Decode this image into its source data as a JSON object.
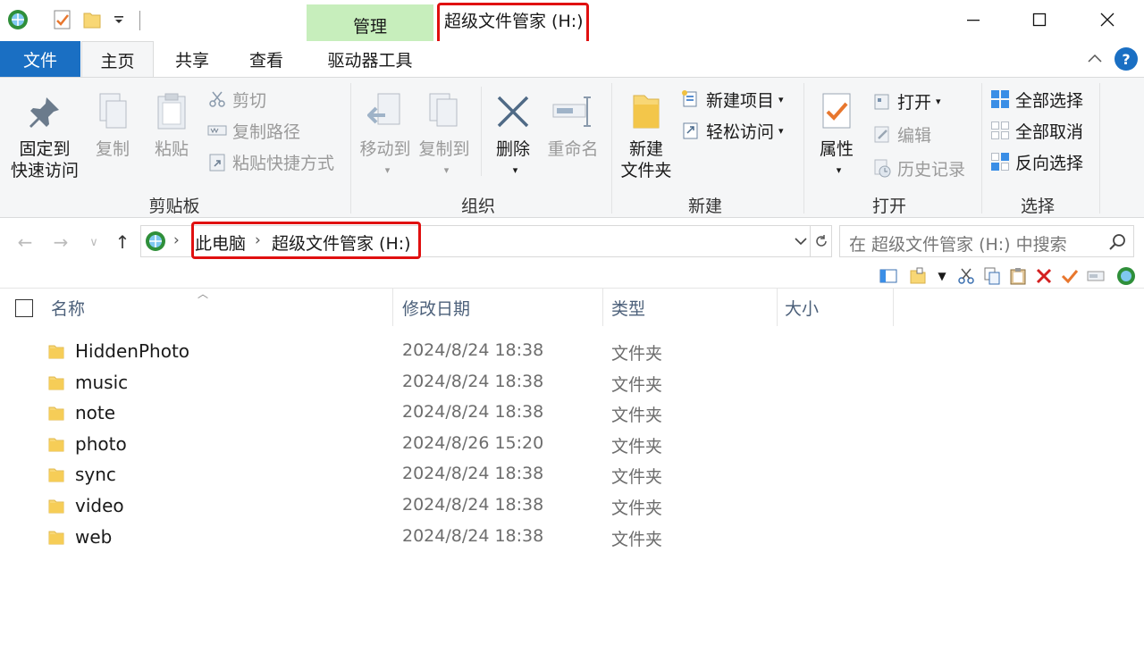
{
  "window": {
    "title": "超级文件管家 (H:)",
    "context_group": "管理",
    "help": "?"
  },
  "tabs": {
    "file": "文件",
    "home": "主页",
    "share": "共享",
    "view": "查看",
    "drive_tools": "驱动器工具"
  },
  "ribbon": {
    "clipboard": {
      "label": "剪贴板",
      "pin_line1": "固定到",
      "pin_line2": "快速访问",
      "copy": "复制",
      "paste": "粘贴",
      "cut": "剪切",
      "copy_path": "复制路径",
      "paste_shortcut": "粘贴快捷方式"
    },
    "organize": {
      "label": "组织",
      "move_to": "移动到",
      "copy_to": "复制到",
      "delete": "删除",
      "rename": "重命名"
    },
    "new": {
      "label": "新建",
      "new_folder_line1": "新建",
      "new_folder_line2": "文件夹",
      "new_item": "新建项目",
      "easy_access": "轻松访问"
    },
    "open": {
      "label": "打开",
      "properties": "属性",
      "open": "打开",
      "edit": "编辑",
      "history": "历史记录"
    },
    "select": {
      "label": "选择",
      "select_all": "全部选择",
      "select_none": "全部取消",
      "invert": "反向选择"
    }
  },
  "address": {
    "crumbs": [
      "此电脑",
      "超级文件管家 (H:)"
    ],
    "search_placeholder": "在 超级文件管家 (H:) 中搜索"
  },
  "columns": {
    "name": "名称",
    "modified": "修改日期",
    "type": "类型",
    "size": "大小"
  },
  "files": [
    {
      "name": "HiddenPhoto",
      "modified": "2024/8/24 18:38",
      "type": "文件夹"
    },
    {
      "name": "music",
      "modified": "2024/8/24 18:38",
      "type": "文件夹"
    },
    {
      "name": "note",
      "modified": "2024/8/24 18:38",
      "type": "文件夹"
    },
    {
      "name": "photo",
      "modified": "2024/8/26 15:20",
      "type": "文件夹"
    },
    {
      "name": "sync",
      "modified": "2024/8/24 18:38",
      "type": "文件夹"
    },
    {
      "name": "video",
      "modified": "2024/8/24 18:38",
      "type": "文件夹"
    },
    {
      "name": "web",
      "modified": "2024/8/24 18:38",
      "type": "文件夹"
    }
  ],
  "colors": {
    "accent": "#1a6fc3",
    "context_tab": "#c7eebc",
    "highlight_box": "#e01010",
    "folder": "#f8d775",
    "delete_x": "#d42020",
    "check": "#e8772e"
  }
}
